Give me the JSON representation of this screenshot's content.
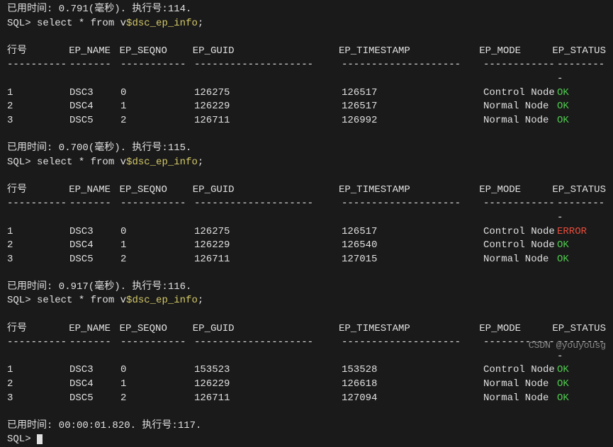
{
  "top_timing": "已用时间: 0.791(毫秒). 执行号:114.",
  "sql_prompt": "SQL>",
  "sql_cmd_prefix": "select * from v",
  "sql_cmd_var": "$dsc_ep_info",
  "sql_cmd_suffix": ";",
  "headers": {
    "row_no": "行号",
    "ep_name": "EP_NAME",
    "ep_seqno": "EP_SEQNO",
    "ep_guid": "EP_GUID",
    "ep_timestamp": "EP_TIMESTAMP",
    "ep_mode": "EP_MODE",
    "ep_status": "EP_STATUS"
  },
  "dashes": {
    "row_no": "----------",
    "ep_name": "-------",
    "ep_seqno": "-----------",
    "ep_guid": "--------------------",
    "ep_timestamp": "--------------------",
    "ep_mode": "------------",
    "ep_status": "---------"
  },
  "block1": {
    "rows": [
      {
        "no": "1",
        "name": "DSC3",
        "seq": "0",
        "guid": "126275",
        "ts": "126517",
        "mode": "Control Node",
        "status": "OK",
        "status_color": "green"
      },
      {
        "no": "2",
        "name": "DSC4",
        "seq": "1",
        "guid": "126229",
        "ts": "126517",
        "mode": "Normal Node",
        "status": "OK",
        "status_color": "green"
      },
      {
        "no": "3",
        "name": "DSC5",
        "seq": "2",
        "guid": "126711",
        "ts": "126992",
        "mode": "Normal Node",
        "status": "OK",
        "status_color": "green"
      }
    ],
    "timing": "已用时间: 0.700(毫秒). 执行号:115."
  },
  "block2": {
    "rows": [
      {
        "no": "1",
        "name": "DSC3",
        "seq": "0",
        "guid": "126275",
        "ts": "126517",
        "mode": "Control Node",
        "status": "ERROR",
        "status_color": "red"
      },
      {
        "no": "2",
        "name": "DSC4",
        "seq": "1",
        "guid": "126229",
        "ts": "126540",
        "mode": "Control Node",
        "status": "OK",
        "status_color": "green"
      },
      {
        "no": "3",
        "name": "DSC5",
        "seq": "2",
        "guid": "126711",
        "ts": "127015",
        "mode": "Normal Node",
        "status": "OK",
        "status_color": "green"
      }
    ],
    "timing": "已用时间: 0.917(毫秒). 执行号:116."
  },
  "block3": {
    "rows": [
      {
        "no": "1",
        "name": "DSC3",
        "seq": "0",
        "guid": "153523",
        "ts": "153528",
        "mode": "Control Node",
        "status": "OK",
        "status_color": "green"
      },
      {
        "no": "2",
        "name": "DSC4",
        "seq": "1",
        "guid": "126229",
        "ts": "126618",
        "mode": "Normal Node",
        "status": "OK",
        "status_color": "green"
      },
      {
        "no": "3",
        "name": "DSC5",
        "seq": "2",
        "guid": "126711",
        "ts": "127094",
        "mode": "Normal Node",
        "status": "OK",
        "status_color": "green"
      }
    ],
    "timing": "已用时间: 00:00:01.820. 执行号:117."
  },
  "watermark": "CSDN @youyousg"
}
